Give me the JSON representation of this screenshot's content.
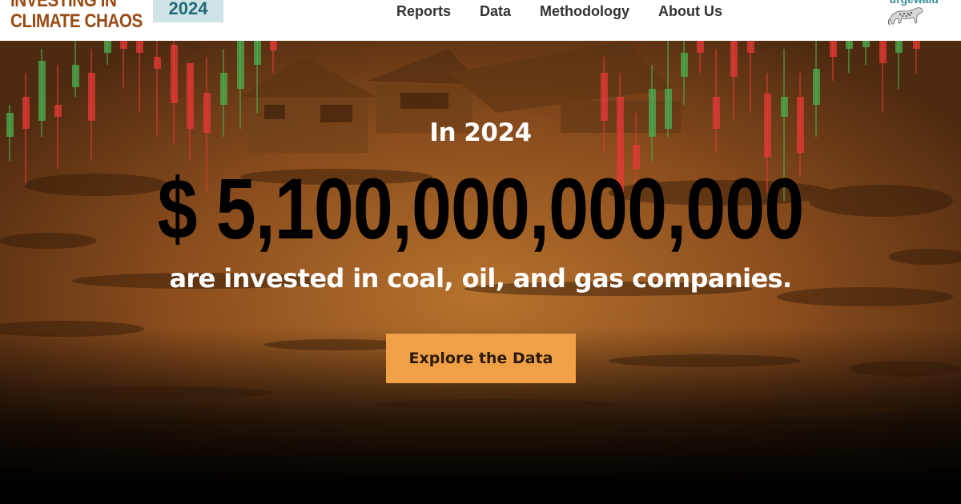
{
  "header": {
    "logo_line_1": "Investing in",
    "logo_line_2": "Climate Chaos",
    "year_badge": "2024",
    "nav": [
      {
        "label": "Reports"
      },
      {
        "label": "Data"
      },
      {
        "label": "Methodology"
      },
      {
        "label": "About Us"
      }
    ],
    "brand_name": "urgewald",
    "brand_icon": "leopard-icon"
  },
  "hero": {
    "kicker": "In 2024",
    "amount": "$ 5,100,000,000,000",
    "subline": "are invested in coal, oil, and gas companies.",
    "cta_label": "Explore the Data",
    "background_description_icon": "flooded-houses-candlestick-image"
  },
  "colors": {
    "logo": "#9a4a14",
    "badge_bg": "#cfe3e7",
    "badge_text": "#1f6a78",
    "cta_bg": "#f0a047",
    "candle_up": "#4caf50",
    "candle_down": "#e53935"
  }
}
